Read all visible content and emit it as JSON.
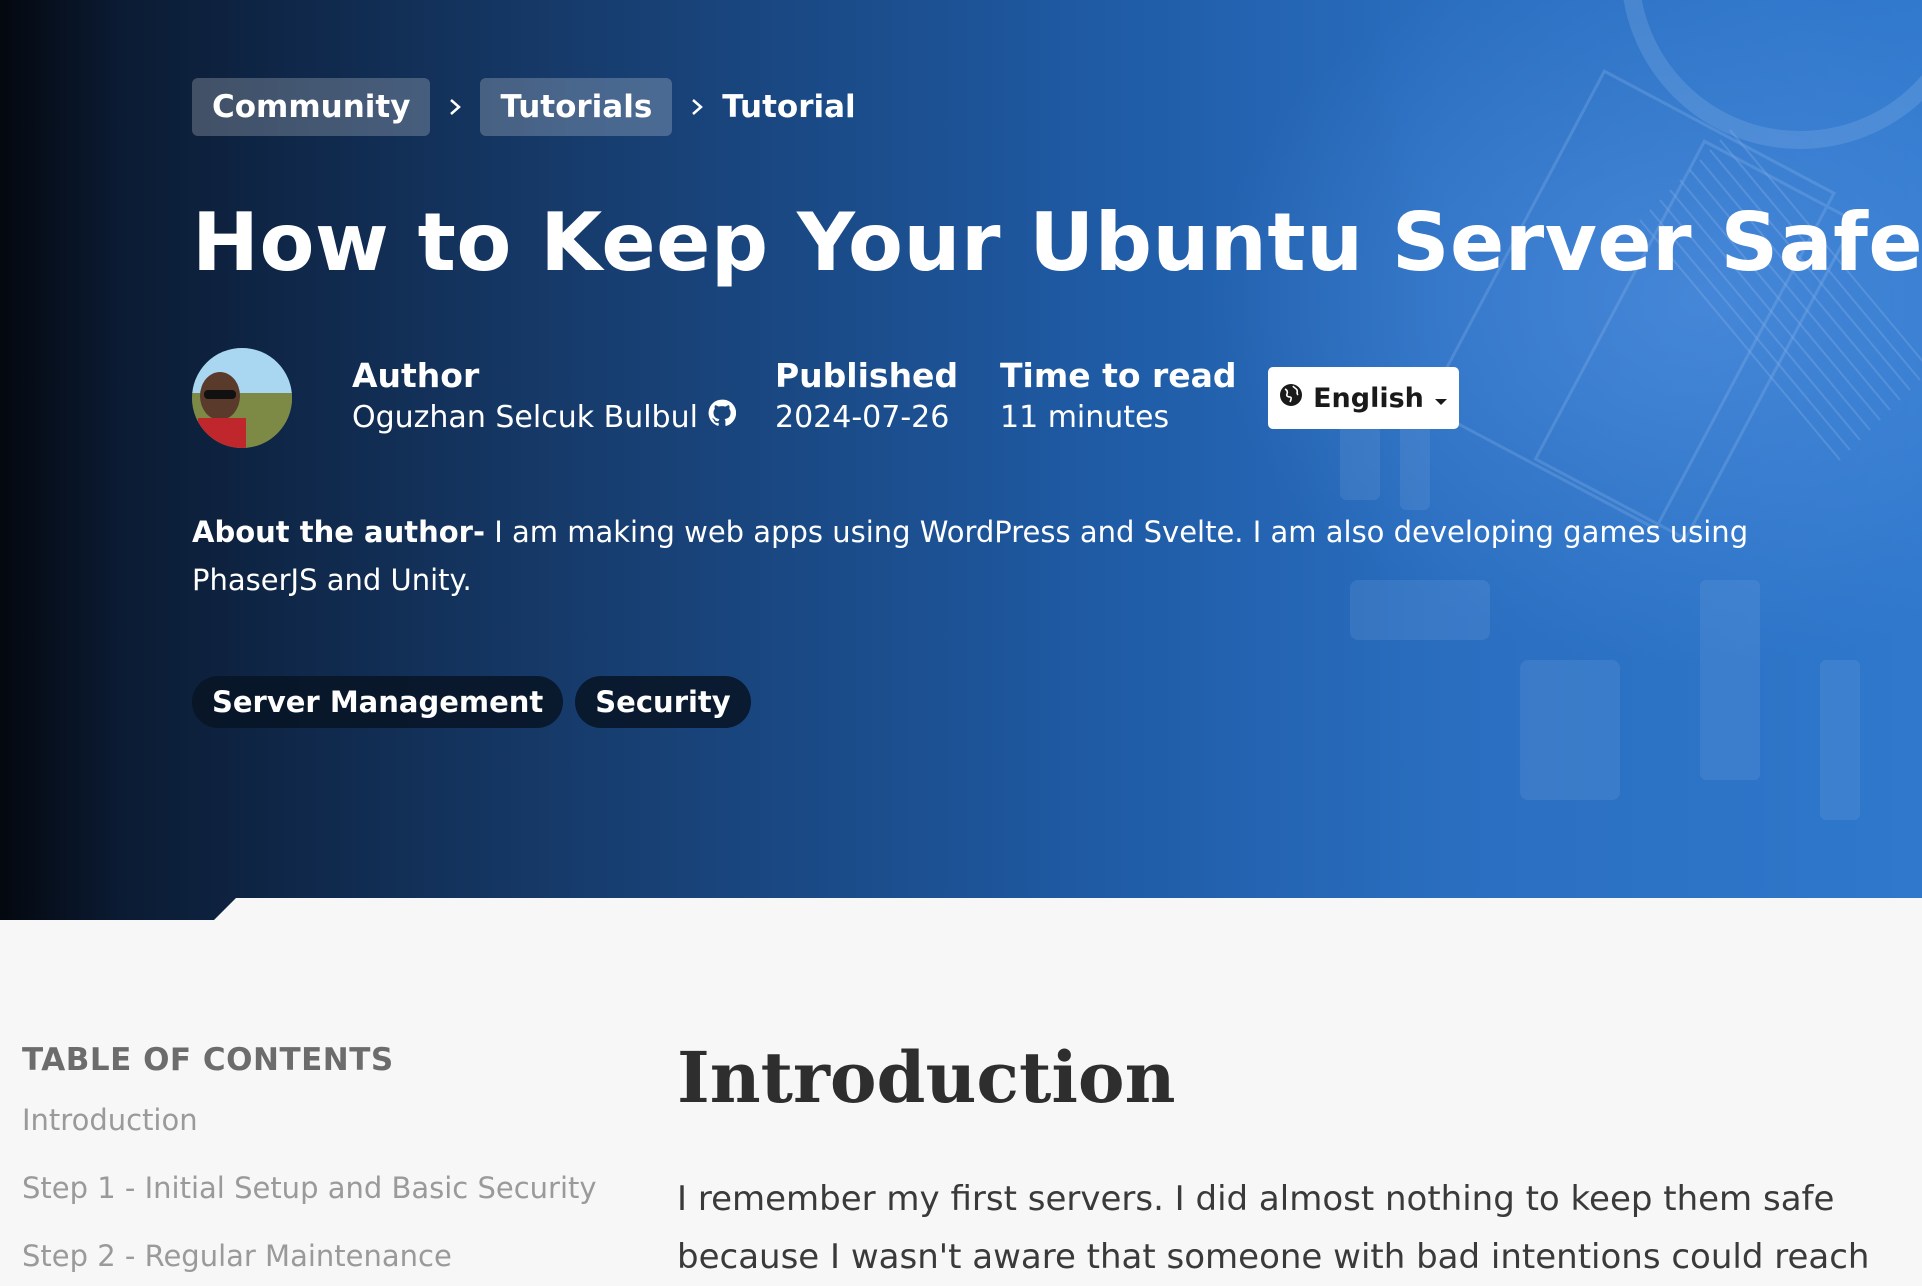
{
  "breadcrumb": {
    "items": [
      "Community",
      "Tutorials"
    ],
    "current": "Tutorial"
  },
  "title": "How to Keep Your Ubuntu Server Safe",
  "meta": {
    "author_label": "Author",
    "author_name": "Oguzhan Selcuk Bulbul",
    "published_label": "Published",
    "published_value": "2024-07-26",
    "ttr_label": "Time to read",
    "ttr_value": "11 minutes"
  },
  "language": {
    "selected": "English"
  },
  "about": {
    "label": "About the author-",
    "text": " I am making web apps using WordPress and Svelte. I am also developing games using PhaserJS and Unity."
  },
  "tags": [
    "Server Management",
    "Security"
  ],
  "toc": {
    "title": "TABLE OF CONTENTS",
    "items": [
      "Introduction",
      "Step 1 - Initial Setup and Basic Security",
      "Step 2 - Regular Maintenance"
    ]
  },
  "article": {
    "heading": "Introduction",
    "paragraph": "I remember my first servers. I did almost nothing to keep them safe because I wasn't aware that someone with bad intentions could reach my server. And"
  },
  "icons": {
    "github": "github-icon",
    "globe": "globe-icon",
    "caret": "caret-down-icon",
    "chevron": "chevron-right-icon"
  },
  "colors": {
    "hero_dark": "#04080f",
    "hero_blue": "#2f78cc",
    "page_bg": "#f7f7f7",
    "tag_bg": "#081426"
  }
}
